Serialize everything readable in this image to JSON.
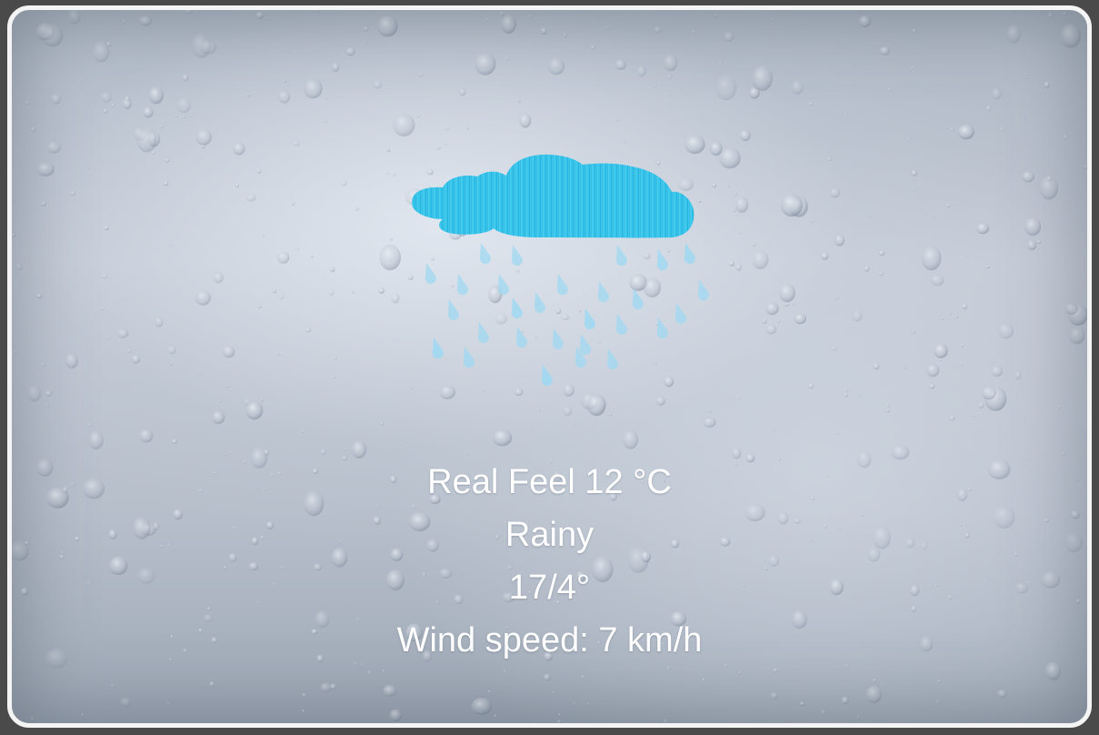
{
  "weather": {
    "icon": "rain-cloud-icon",
    "real_feel": "Real Feel 12 °C",
    "condition": "Rainy",
    "temp_range": "17/4°",
    "wind": "Wind speed: 7 km/h"
  },
  "colors": {
    "cloud": "#33c7ec",
    "rain_drops": "#9fd8f2",
    "card_border": "#f4f4f4",
    "text": "#ffffff"
  }
}
